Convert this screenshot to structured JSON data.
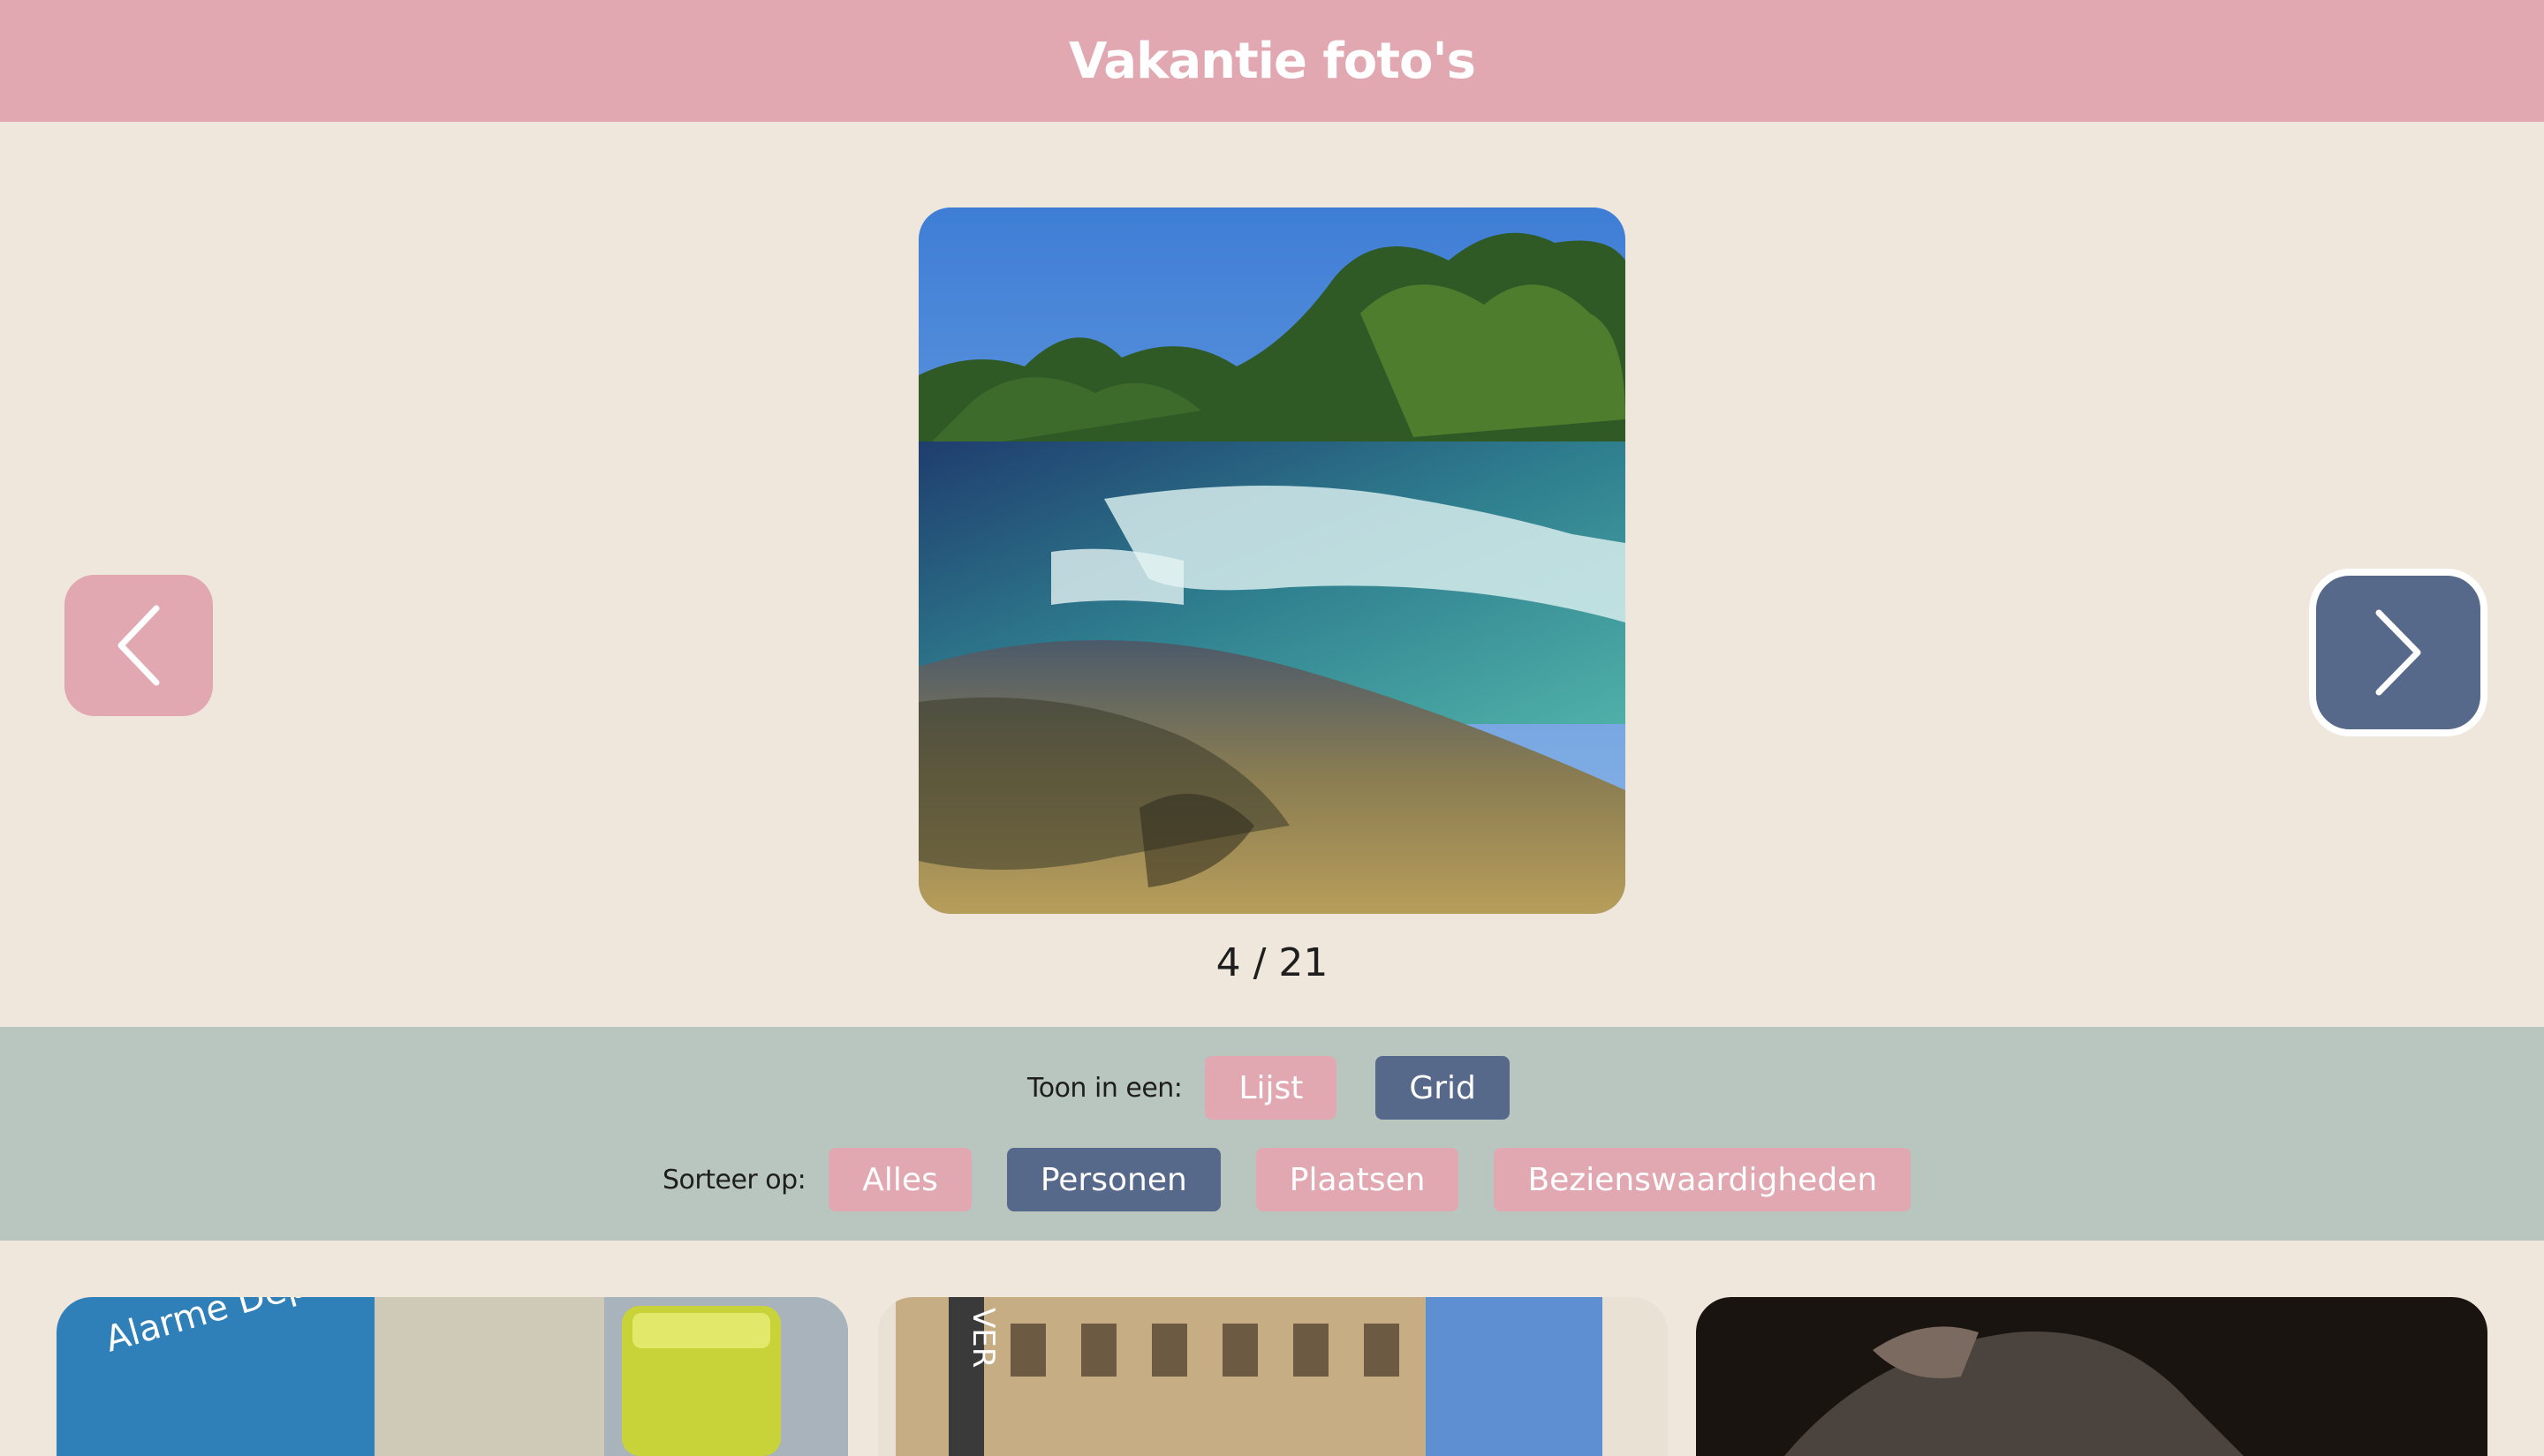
{
  "header": {
    "title": "Vakantie foto's"
  },
  "slideshow": {
    "current": 4,
    "total": 21,
    "counter_text": "4 / 21",
    "prev_icon": "chevron-left-icon",
    "next_icon": "chevron-right-icon"
  },
  "view_options": {
    "label": "Toon in een:",
    "options": [
      {
        "label": "Lijst",
        "selected": false
      },
      {
        "label": "Grid",
        "selected": true
      }
    ]
  },
  "sort_options": {
    "label": "Sorteer op:",
    "options": [
      {
        "label": "Alles",
        "selected": false
      },
      {
        "label": "Personen",
        "selected": true
      },
      {
        "label": "Plaatsen",
        "selected": false
      },
      {
        "label": "Bezienswaardigheden",
        "selected": false
      }
    ]
  },
  "thumbnails": [
    {
      "text": "Alarme Dépannage la porte /Alu"
    },
    {
      "text": "VER"
    },
    {
      "text": ""
    }
  ],
  "colors": {
    "header": "#e2a8b2",
    "background": "#efe6dc",
    "toolbar": "#b9c6c0",
    "accent_pink": "#e2a8b2",
    "accent_slate": "#56698a"
  }
}
